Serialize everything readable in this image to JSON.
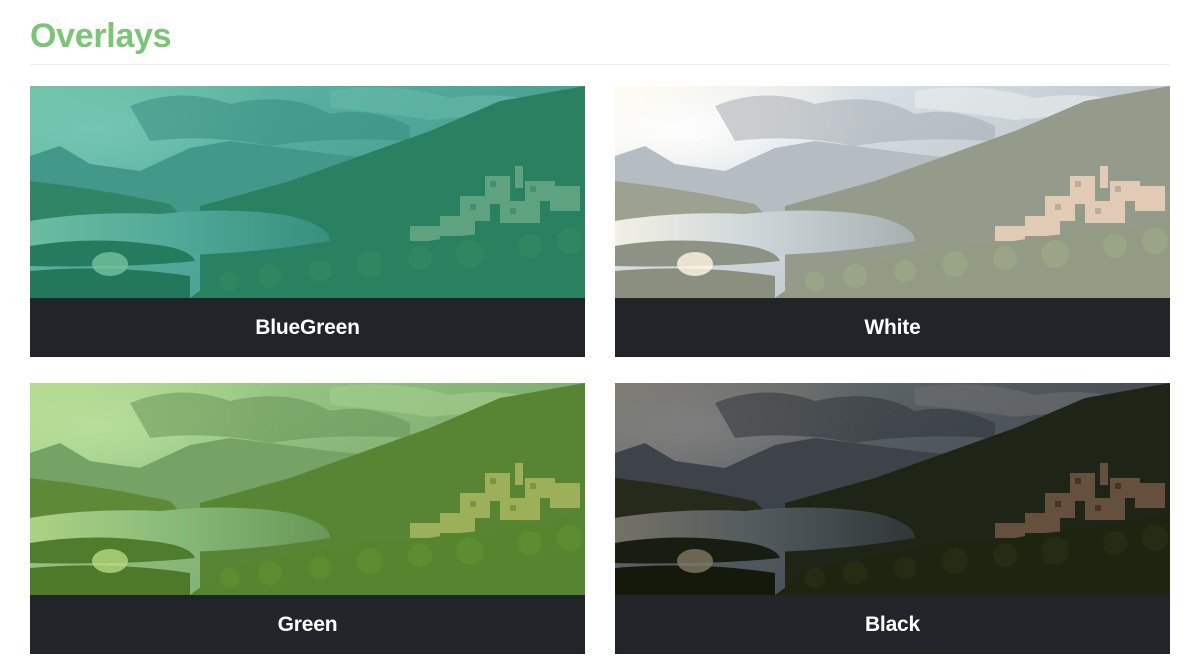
{
  "page": {
    "title": "Overlays"
  },
  "cards": [
    {
      "caption": "BlueGreen",
      "overlay_color": "#1fa385",
      "overlay_opacity": 0.62
    },
    {
      "caption": "White",
      "overlay_color": "#ffffff",
      "overlay_opacity": 0.45
    },
    {
      "caption": "Green",
      "overlay_color": "#6fbf3a",
      "overlay_opacity": 0.5
    },
    {
      "caption": "Black",
      "overlay_color": "#000000",
      "overlay_opacity": 0.5
    }
  ],
  "image": {
    "subject": "landscape-lake-village-photo"
  }
}
